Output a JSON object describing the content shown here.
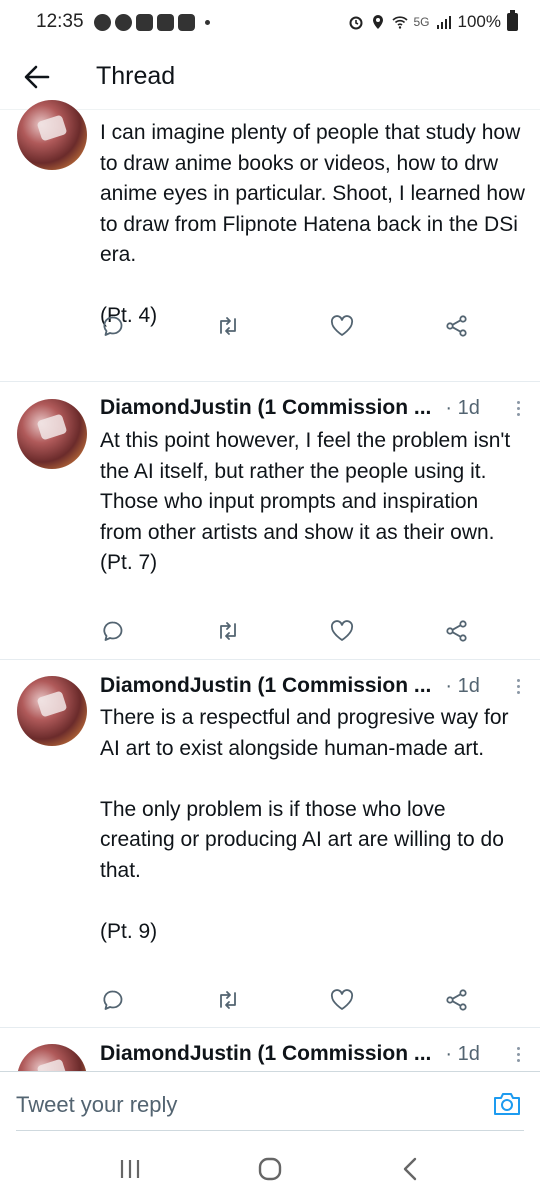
{
  "status_bar": {
    "time": "12:35",
    "network": "5G",
    "battery": "100%"
  },
  "header": {
    "title": "Thread"
  },
  "colors": {
    "icon_gray": "#536471",
    "accent": "#1d9bf0",
    "divider": "#e6ecf0"
  },
  "tweets": [
    {
      "author": "",
      "time": "",
      "text": [
        "I can imagine plenty of people that study how to draw anime books or videos, how to drw anime eyes in particular. Shoot, I learned how to draw from Flipnote Hatena back in the DSi era.",
        "",
        "(Pt. 4)"
      ]
    },
    {
      "author": "DiamondJustin (1 Commission ...",
      "time": "· 1d",
      "text": [
        "At this point however, I feel the problem isn't the AI itself, but rather the people using it. Those who input prompts and inspiration from other artists and show it as their own.",
        "(Pt. 7)"
      ]
    },
    {
      "author": "DiamondJustin (1 Commission ...",
      "time": "· 1d",
      "text": [
        "There is a respectful and progresive way for AI art to exist alongside human-made art.",
        "",
        "The only problem is if those who love creating or producing AI art are willing to do that.",
        "",
        "(Pt. 9)"
      ]
    },
    {
      "author": "DiamondJustin (1 Commission ...",
      "time": "· 1d",
      "text": []
    }
  ],
  "reply": {
    "placeholder": "Tweet your reply"
  },
  "icons": {
    "back": "arrow-left-icon",
    "reply": "comment-icon",
    "retweet": "retweet-icon",
    "like": "heart-icon",
    "share": "share-icon",
    "camera": "camera-icon",
    "nav_recents": "recents-icon",
    "nav_home": "home-icon",
    "nav_back": "chevron-left-icon"
  }
}
